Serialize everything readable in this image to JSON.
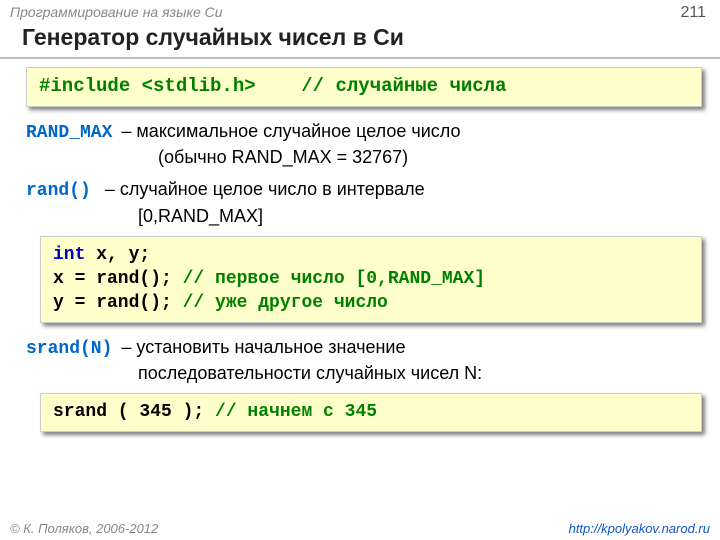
{
  "header": {
    "course": "Программирование на языке Си",
    "page": "211"
  },
  "title": "Генератор случайных чисел в Си",
  "box1": {
    "include": "#include <stdlib.h>",
    "comment": "// случайные числа"
  },
  "randmax": {
    "name": "RAND_MAX",
    "desc": " – максимальное случайное целое число",
    "sub": "(обычно RAND_MAX = 32767)"
  },
  "rand": {
    "name": "rand()",
    "desc": " – случайное целое число в интервале",
    "sub": "[0,RAND_MAX]"
  },
  "box2": {
    "l1a": "int",
    "l1b": " x, y;",
    "l2a": "x = rand(); ",
    "l2b": "// первое число [0,RAND_MAX]",
    "l3a": "y = rand(); ",
    "l3b": "// уже другое число"
  },
  "srand": {
    "name": "srand(N)",
    "desc": " – установить начальное значение",
    "sub": "последовательности случайных чисел N:"
  },
  "box3": {
    "code": "srand ( 345 ); ",
    "comment": "// начнем с 345"
  },
  "footer": {
    "copyright": "© К. Поляков, 2006-2012",
    "url": "http://kpolyakov.narod.ru"
  }
}
